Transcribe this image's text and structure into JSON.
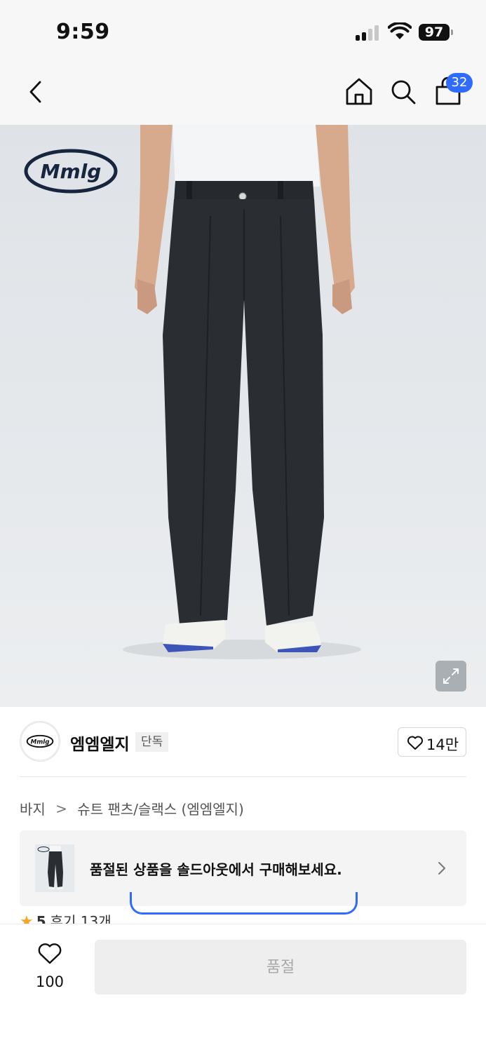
{
  "status_bar": {
    "time": "9:59",
    "battery": "97"
  },
  "nav": {
    "cart_count": "32"
  },
  "product": {
    "brand_logo_text": "Mmlg"
  },
  "brand": {
    "name": "엠엠엘지",
    "badge": "단독",
    "like_count": "14만"
  },
  "breadcrumb": {
    "category": "바지",
    "separator": ">",
    "subcategory": "슈트 팬츠/슬랙스 (엠엠엘지)"
  },
  "soldout_banner": {
    "text": "품절된 상품을 솔드아웃에서 구매해보세요."
  },
  "rating": {
    "score": "5",
    "reviews": "후기 13개"
  },
  "bottom_bar": {
    "wish_count": "100",
    "buy_label": "품절"
  },
  "colors": {
    "accent": "#2f6bff",
    "star": "#f5a623",
    "disabled_button": "#eeeeee",
    "disabled_text": "#a9a9a9"
  }
}
